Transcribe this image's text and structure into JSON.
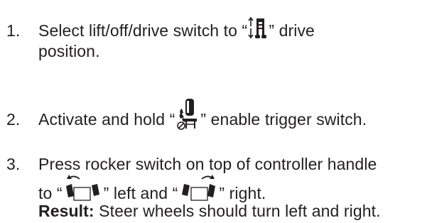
{
  "steps": [
    {
      "number": "1.",
      "line1_before": "Select lift/off/drive switch to “",
      "line1_after": "” drive",
      "line2": "position.",
      "icon": "drive-position-icon"
    },
    {
      "number": "2.",
      "before": "Activate and hold “",
      "after": "” enable trigger switch.",
      "icon": "enable-trigger-icon"
    },
    {
      "number": "3.",
      "line1": "Press rocker switch on top of controller handle",
      "line2_a": "to “",
      "line2_b": "” left and “",
      "line2_c": "” right.",
      "result_label": "Result:",
      "result_text": " Steer wheels should turn left and right.",
      "icons": [
        "steer-left-icon",
        "steer-right-icon"
      ]
    }
  ]
}
